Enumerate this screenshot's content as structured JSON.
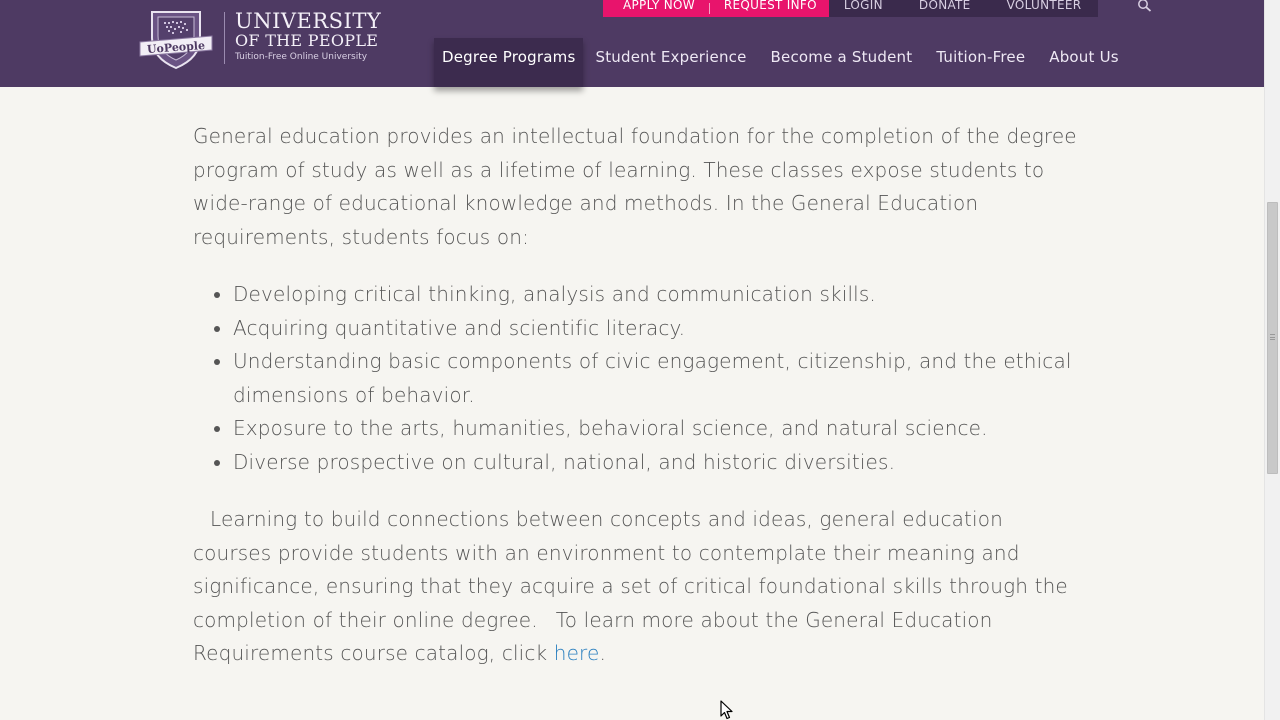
{
  "header": {
    "logo": {
      "badge_text": "UoPeople",
      "line1": "UNIVERSITY",
      "line2": "OF THE PEOPLE",
      "tagline": "Tuition-Free Online University"
    },
    "utility": {
      "apply_now": "APPLY NOW",
      "request_info": "REQUEST INFO",
      "login": "LOGIN",
      "donate": "DONATE",
      "volunteer": "VOLUNTEER"
    },
    "nav": [
      {
        "label": "Degree Programs",
        "active": true
      },
      {
        "label": "Student Experience"
      },
      {
        "label": "Become a Student"
      },
      {
        "label": "Tuition-Free"
      },
      {
        "label": "About Us"
      }
    ]
  },
  "content": {
    "intro": "General education provides an intellectual foundation for the completion of the degree program of study as well as a lifetime of learning. These classes expose students to wide-range of educational knowledge and methods. In the General Education requirements, students focus on:",
    "bullets": [
      "Developing critical thinking, analysis and communication skills.",
      "Acquiring quantitative and scientific literacy.",
      "Understanding basic components of civic engagement, citizenship, and the ethical dimensions of behavior.",
      "Exposure to the arts, humanities, behavioral science, and natural science.",
      "Diverse prospective on cultural, national, and historic diversities."
    ],
    "closing_part1": "Learning to build connections between concepts and ideas, general education courses provide students with an environment to contemplate their meaning and significance, ensuring that they acquire a set of critical foundational skills through the completion of their online degree.",
    "closing_part2": "To learn more about the General Education Requirements course catalog, click ",
    "link_text": "here",
    "closing_end": "."
  },
  "colors": {
    "header_bg": "#4e3a63",
    "accent_pink": "#e8146c",
    "link": "#2a7fbf",
    "body_text": "#555555"
  }
}
